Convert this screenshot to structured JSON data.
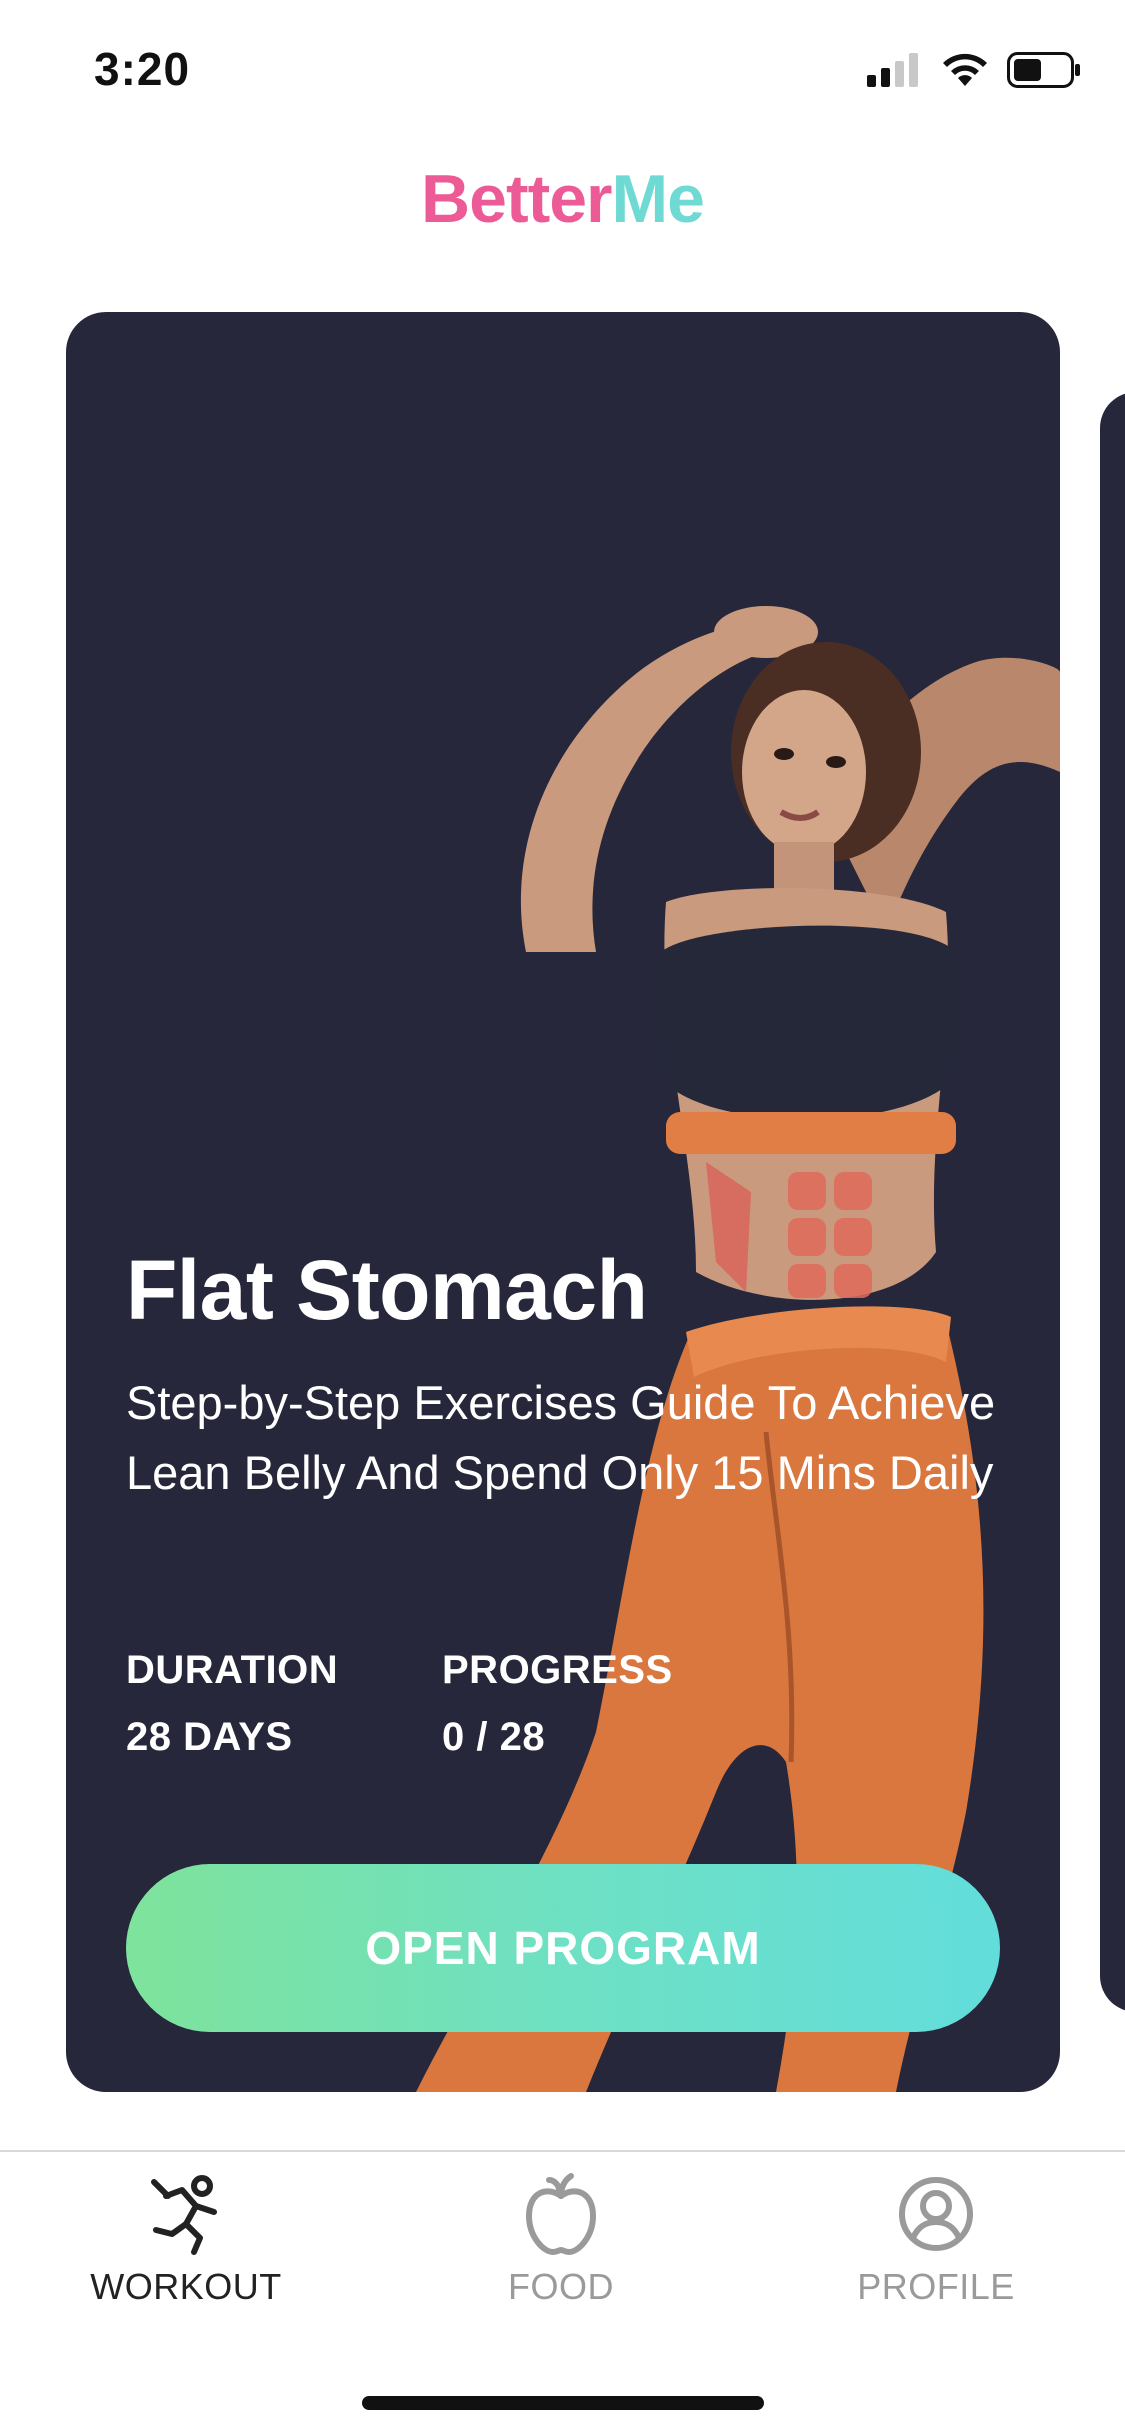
{
  "status_bar": {
    "time": "3:20",
    "icons": [
      "cellular-signal-icon",
      "wifi-icon",
      "battery-icon"
    ]
  },
  "header": {
    "logo_part1": "Better",
    "logo_part2": "Me",
    "logo_colors": {
      "better": "#ec5b95",
      "me": "#6fdad3"
    }
  },
  "program_card": {
    "title": "Flat Stomach",
    "subtitle": "Step-by-Step Exercises Guide To Achieve Lean Belly And Spend Only 15 Mins Daily",
    "duration_label": "DURATION",
    "duration_value": "28 DAYS",
    "progress_label": "PROGRESS",
    "progress_value": "0 / 28",
    "button_label": "OPEN PROGRAM",
    "background_color": "#26273a",
    "button_gradient": [
      "#7ee39b",
      "#62dddb"
    ]
  },
  "tab_bar": {
    "tabs": [
      {
        "label": "WORKOUT",
        "icon": "running-person-icon",
        "active": true
      },
      {
        "label": "FOOD",
        "icon": "apple-icon",
        "active": false
      },
      {
        "label": "PROFILE",
        "icon": "user-circle-icon",
        "active": false
      }
    ]
  }
}
